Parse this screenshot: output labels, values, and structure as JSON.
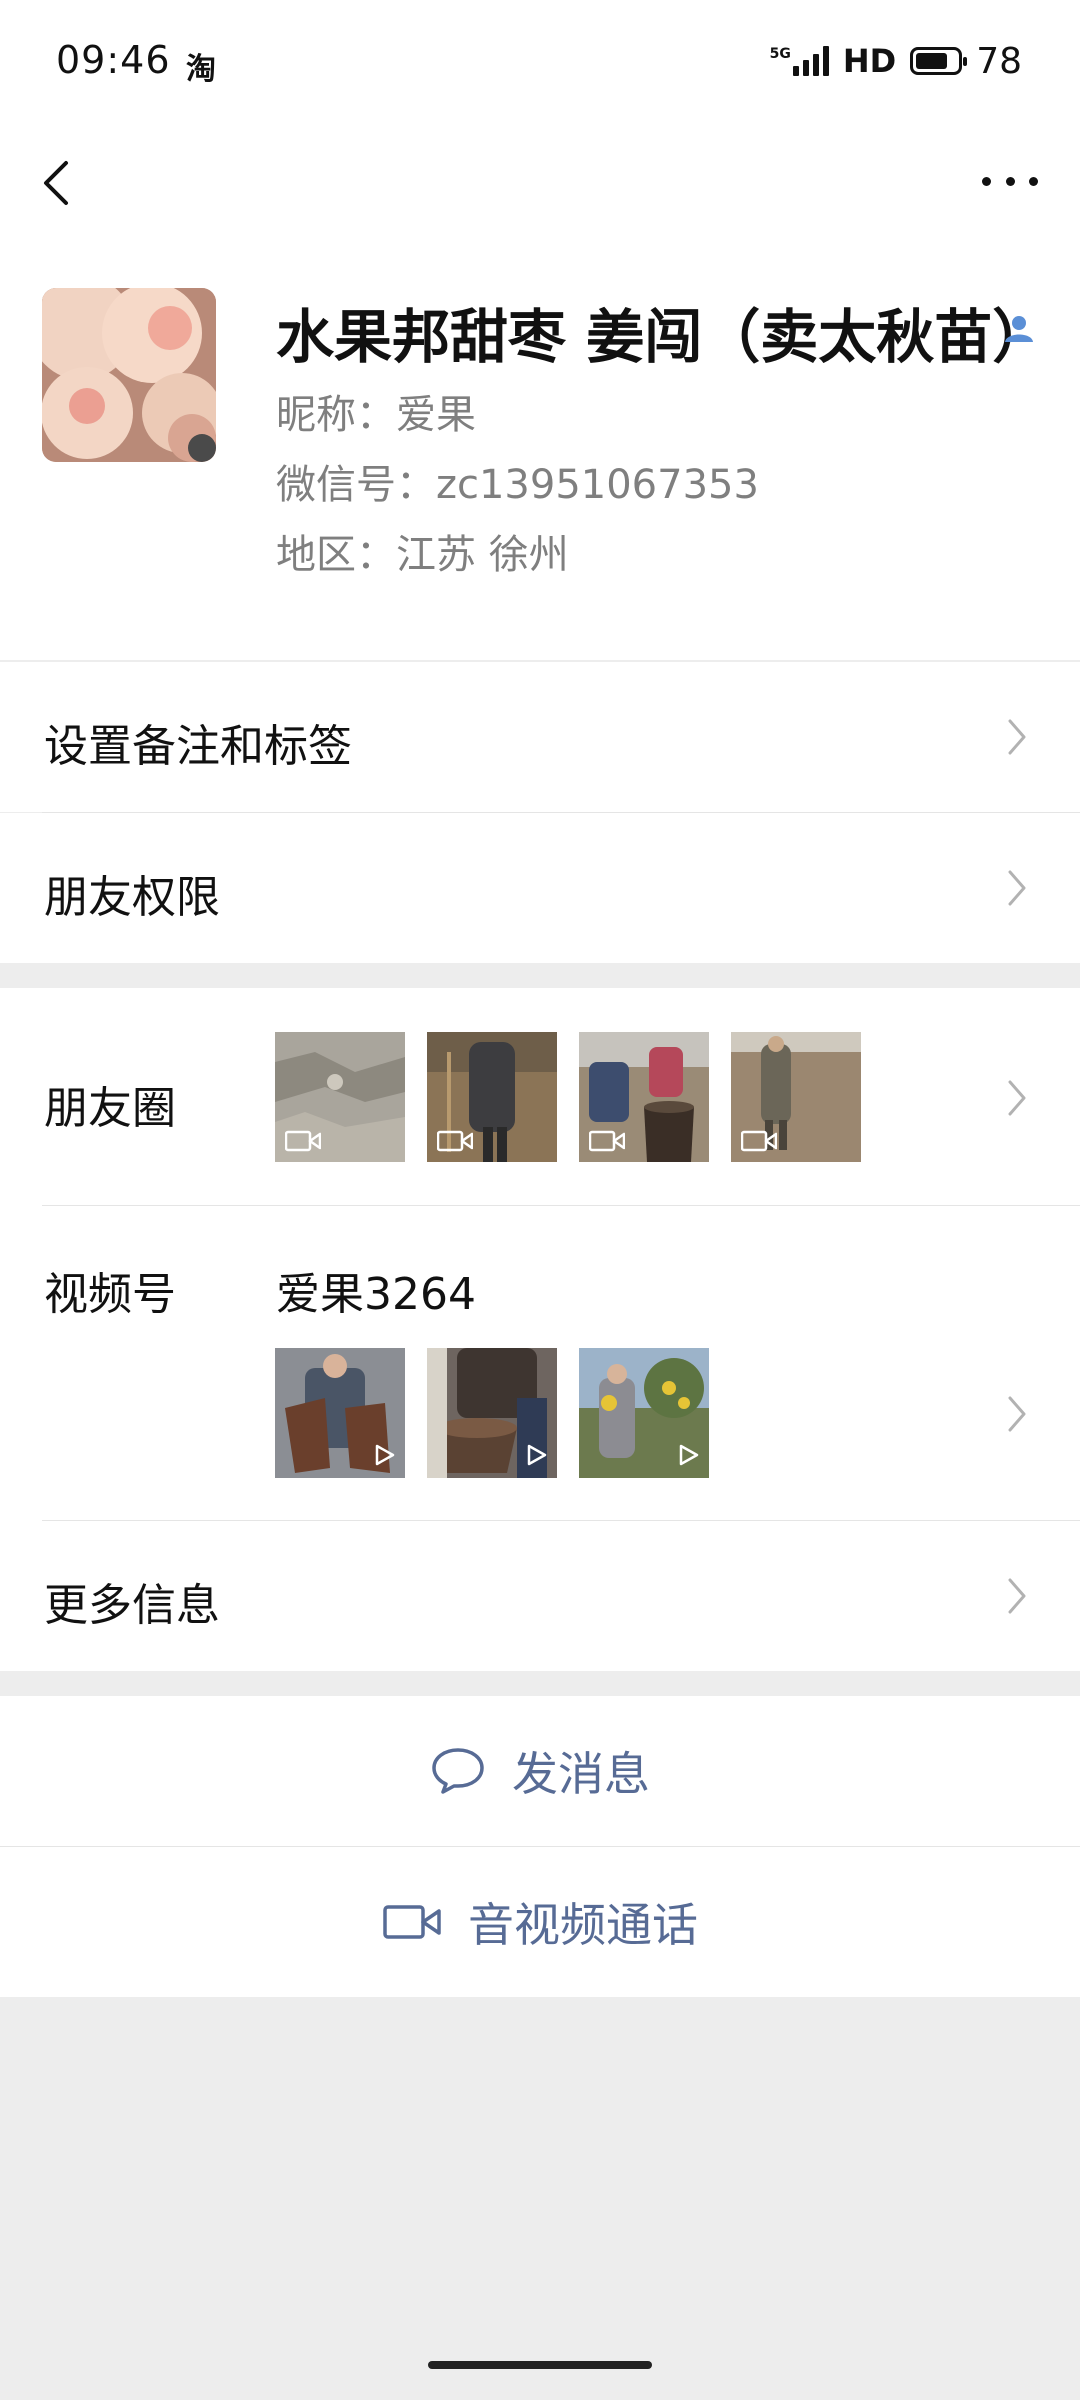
{
  "status_bar": {
    "time": "09:46",
    "app_icon_text": "淘",
    "network": "5G",
    "hd": "HD",
    "battery": "78"
  },
  "nav": {
    "back_icon": "chevron-left-icon",
    "more_icon": "more-dots-icon"
  },
  "profile": {
    "name": "水果邦甜枣 姜闯（卖太秋苗）",
    "nickname": "昵称：爱果",
    "wechat_id": "微信号：zc13951067353",
    "region": "地区：江苏  徐州"
  },
  "rows": {
    "remark_tags": "设置备注和标签",
    "friend_permissions": "朋友权限",
    "moments": "朋友圈",
    "channels": "视频号",
    "channels_name": "爱果3264",
    "more_info": "更多信息"
  },
  "actions": {
    "message": "发消息",
    "call": "音视频通话"
  },
  "colors": {
    "link": "#576b95",
    "background": "#ededed"
  }
}
